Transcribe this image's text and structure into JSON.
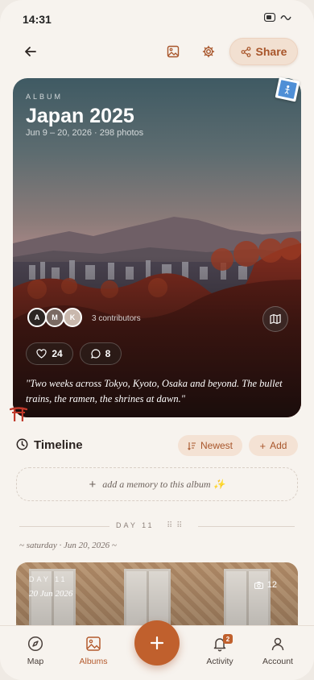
{
  "status_bar": {
    "time": "14:31"
  },
  "header": {
    "share_label": "Share"
  },
  "album": {
    "tag": "ALBUM",
    "title": "Japan 2025",
    "meta": "Jun 9 – 20, 2026 · 298 photos",
    "contributors": [
      {
        "initial": "A"
      },
      {
        "initial": "M"
      },
      {
        "initial": "K"
      }
    ],
    "contributors_label": "3 contributors",
    "likes": "24",
    "comments": "8",
    "quote": "\"Two weeks across Tokyo, Kyoto, Osaka and beyond. The bullet trains, the ramen, the shrines at dawn.\""
  },
  "timeline": {
    "title": "Timeline",
    "sort_label": "Newest",
    "add_label": "Add",
    "add_memory_text": "add a memory to this album ✨",
    "day_label": "DAY 11",
    "day_date": "~ saturday · Jun 20, 2026 ~",
    "card": {
      "day": "DAY 11",
      "date": "20 Jun 2026",
      "photo_count": "12"
    }
  },
  "nav": {
    "map": "Map",
    "albums": "Albums",
    "activity": "Activity",
    "account": "Account",
    "activity_badge": "2",
    "active": "albums"
  },
  "colors": {
    "accent": "#c0602d",
    "background": "#f7f3ee",
    "chip_bg": "#f4e2d4"
  }
}
